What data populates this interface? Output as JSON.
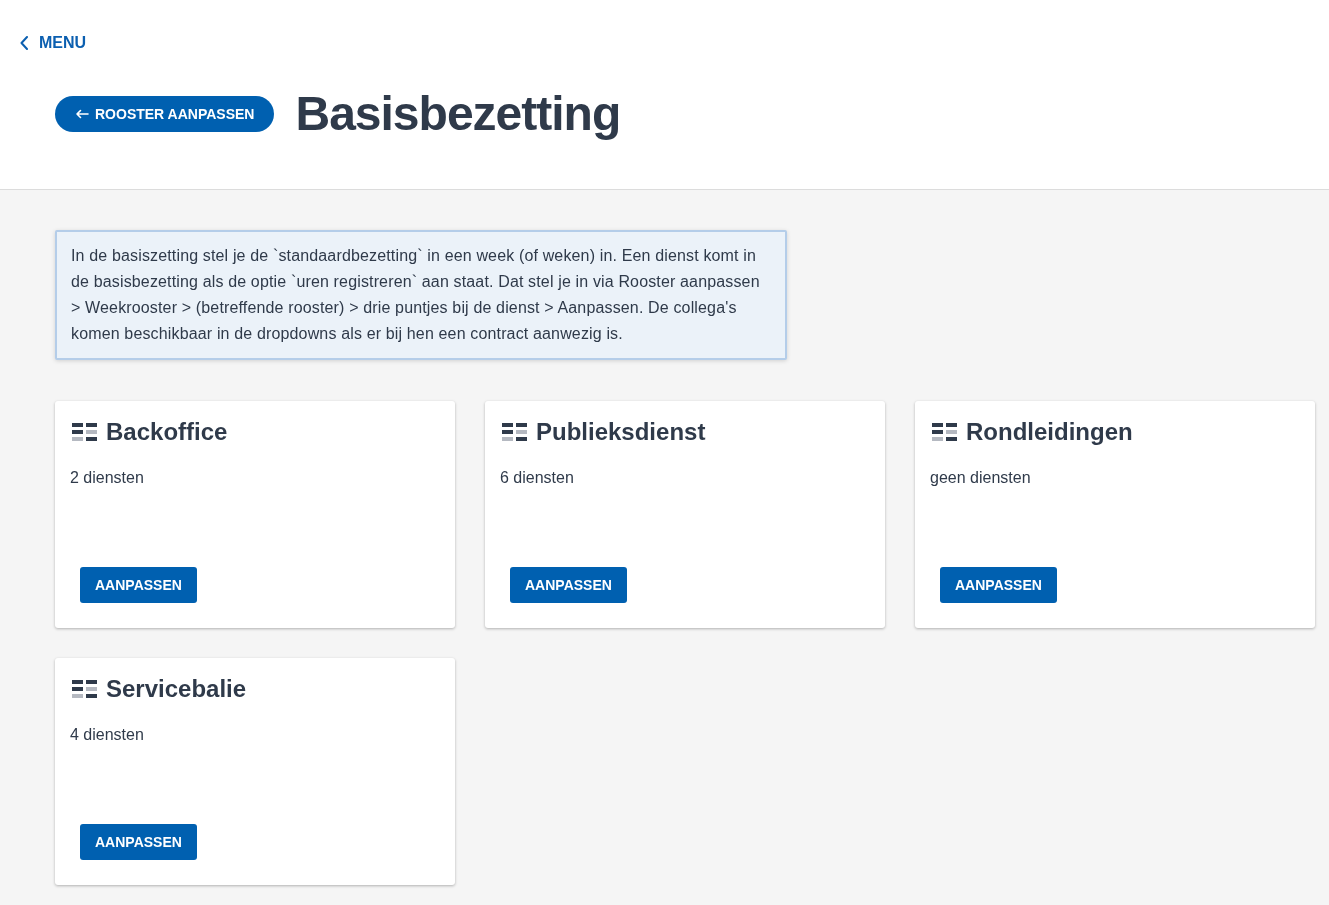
{
  "nav": {
    "back_link": "MENU"
  },
  "header": {
    "back_button": "ROOSTER AANPASSEN",
    "title": "Basisbezetting"
  },
  "info": "In de basiszetting stel je de `standaardbezetting` in een week (of weken) in. Een dienst komt in de basisbezetting als de optie `uren registreren` aan staat. Dat stel je in via Rooster aanpassen > Weekrooster > (betreffende rooster) > drie puntjes bij de dienst > Aanpassen. De collega's komen beschikbaar in de dropdowns als er bij hen een contract aanwezig is.",
  "cards": [
    {
      "title": "Backoffice",
      "subtitle": "2 diensten",
      "button": "AANPASSEN"
    },
    {
      "title": "Publieksdienst",
      "subtitle": "6 diensten",
      "button": "AANPASSEN"
    },
    {
      "title": "Rondleidingen",
      "subtitle": "geen diensten",
      "button": "AANPASSEN"
    },
    {
      "title": "Servicebalie",
      "subtitle": "4 diensten",
      "button": "AANPASSEN"
    }
  ]
}
